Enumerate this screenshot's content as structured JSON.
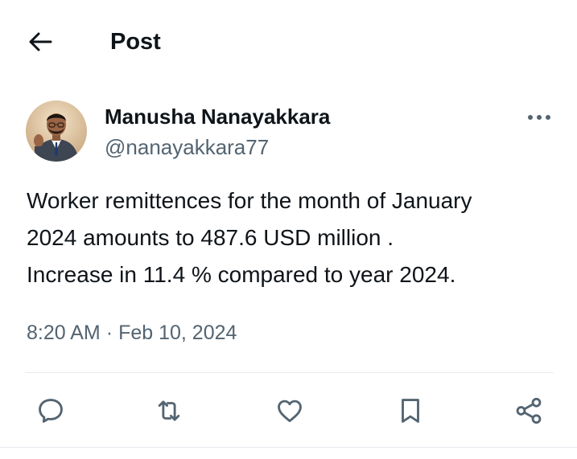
{
  "header": {
    "back_icon": "arrow-left-icon",
    "title": "Post"
  },
  "post": {
    "author": {
      "name": "Manusha Nanayakkara",
      "handle": "@nanayakkara77",
      "avatar_icon": "avatar-photo"
    },
    "more_icon": "more-horizontal-icon",
    "text": "Worker remittences for the month of January\n2024 amounts to 487.6 USD million .\nIncrease in 11.4 % compared to year 2024.",
    "time": "8:20 AM",
    "separator": "·",
    "date": "Feb 10, 2024"
  },
  "actions": [
    {
      "icon": "reply-icon"
    },
    {
      "icon": "repost-icon"
    },
    {
      "icon": "like-heart-icon"
    },
    {
      "icon": "bookmark-icon"
    },
    {
      "icon": "share-icon"
    }
  ],
  "colors": {
    "text_primary": "#0f1419",
    "text_secondary": "#536471",
    "divider": "#e6ecf0",
    "action_icon": "#536471"
  }
}
